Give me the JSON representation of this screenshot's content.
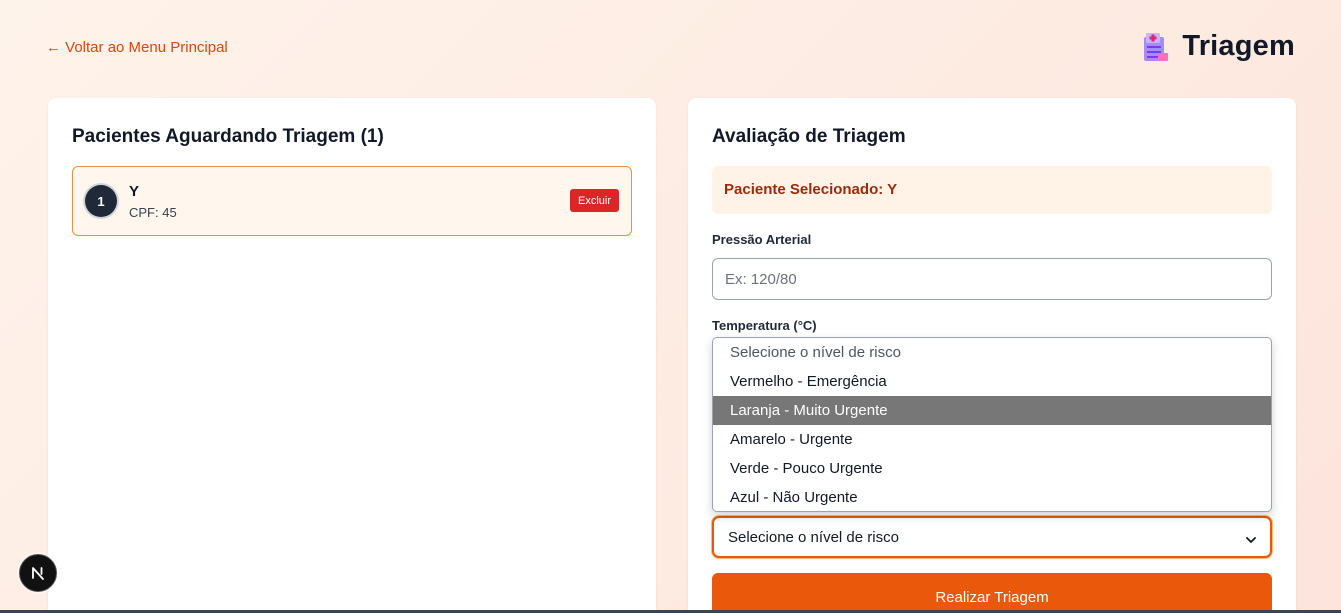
{
  "nav": {
    "back_label": "← Voltar ao Menu Principal"
  },
  "header": {
    "title": "Triagem",
    "icon": "hospital-icon"
  },
  "queue": {
    "title": "Pacientes Aguardando Triagem (1)",
    "patients": [
      {
        "number": "1",
        "name": "Y",
        "cpf": "CPF: 45",
        "delete_label": "Excluir"
      }
    ]
  },
  "assessment": {
    "title": "Avaliação de Triagem",
    "selected_patient": "Paciente Selecionado: Y",
    "blood_pressure": {
      "label": "Pressão Arterial",
      "placeholder": "Ex: 120/80",
      "value": ""
    },
    "temperature": {
      "label": "Temperatura (°C)"
    },
    "risk_select": {
      "selected": "Selecione o nível de risco",
      "options": [
        "Selecione o nível de risco",
        "Vermelho - Emergência",
        "Laranja - Muito Urgente",
        "Amarelo - Urgente",
        "Verde - Pouco Urgente",
        "Azul - Não Urgente"
      ],
      "highlighted_index": 2
    },
    "submit_label": "Realizar Triagem"
  },
  "badge": {
    "letter": "N"
  },
  "colors": {
    "accent": "#ea580c",
    "link": "#d9480f",
    "danger": "#dc2626",
    "highlight": "#777777"
  }
}
